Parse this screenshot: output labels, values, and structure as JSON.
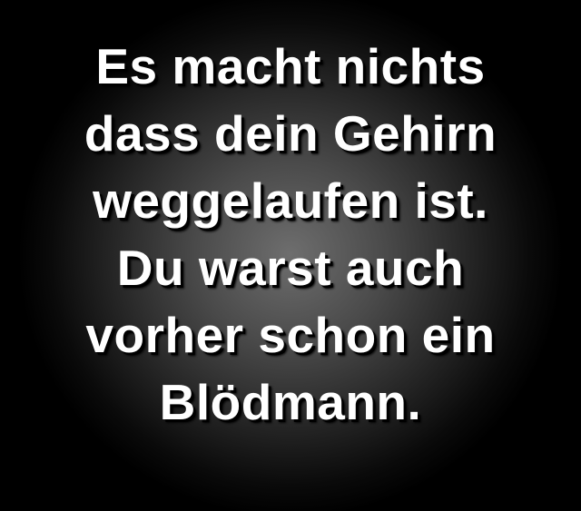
{
  "quote": {
    "lines": [
      "Es macht nichts",
      "dass dein Gehirn",
      "weggelaufen ist.",
      "Du warst auch",
      "vorher schon ein",
      "Blödmann."
    ]
  },
  "colors": {
    "text": "#ffffff",
    "background_center": "#6e6e6e",
    "background_edge": "#000000"
  }
}
